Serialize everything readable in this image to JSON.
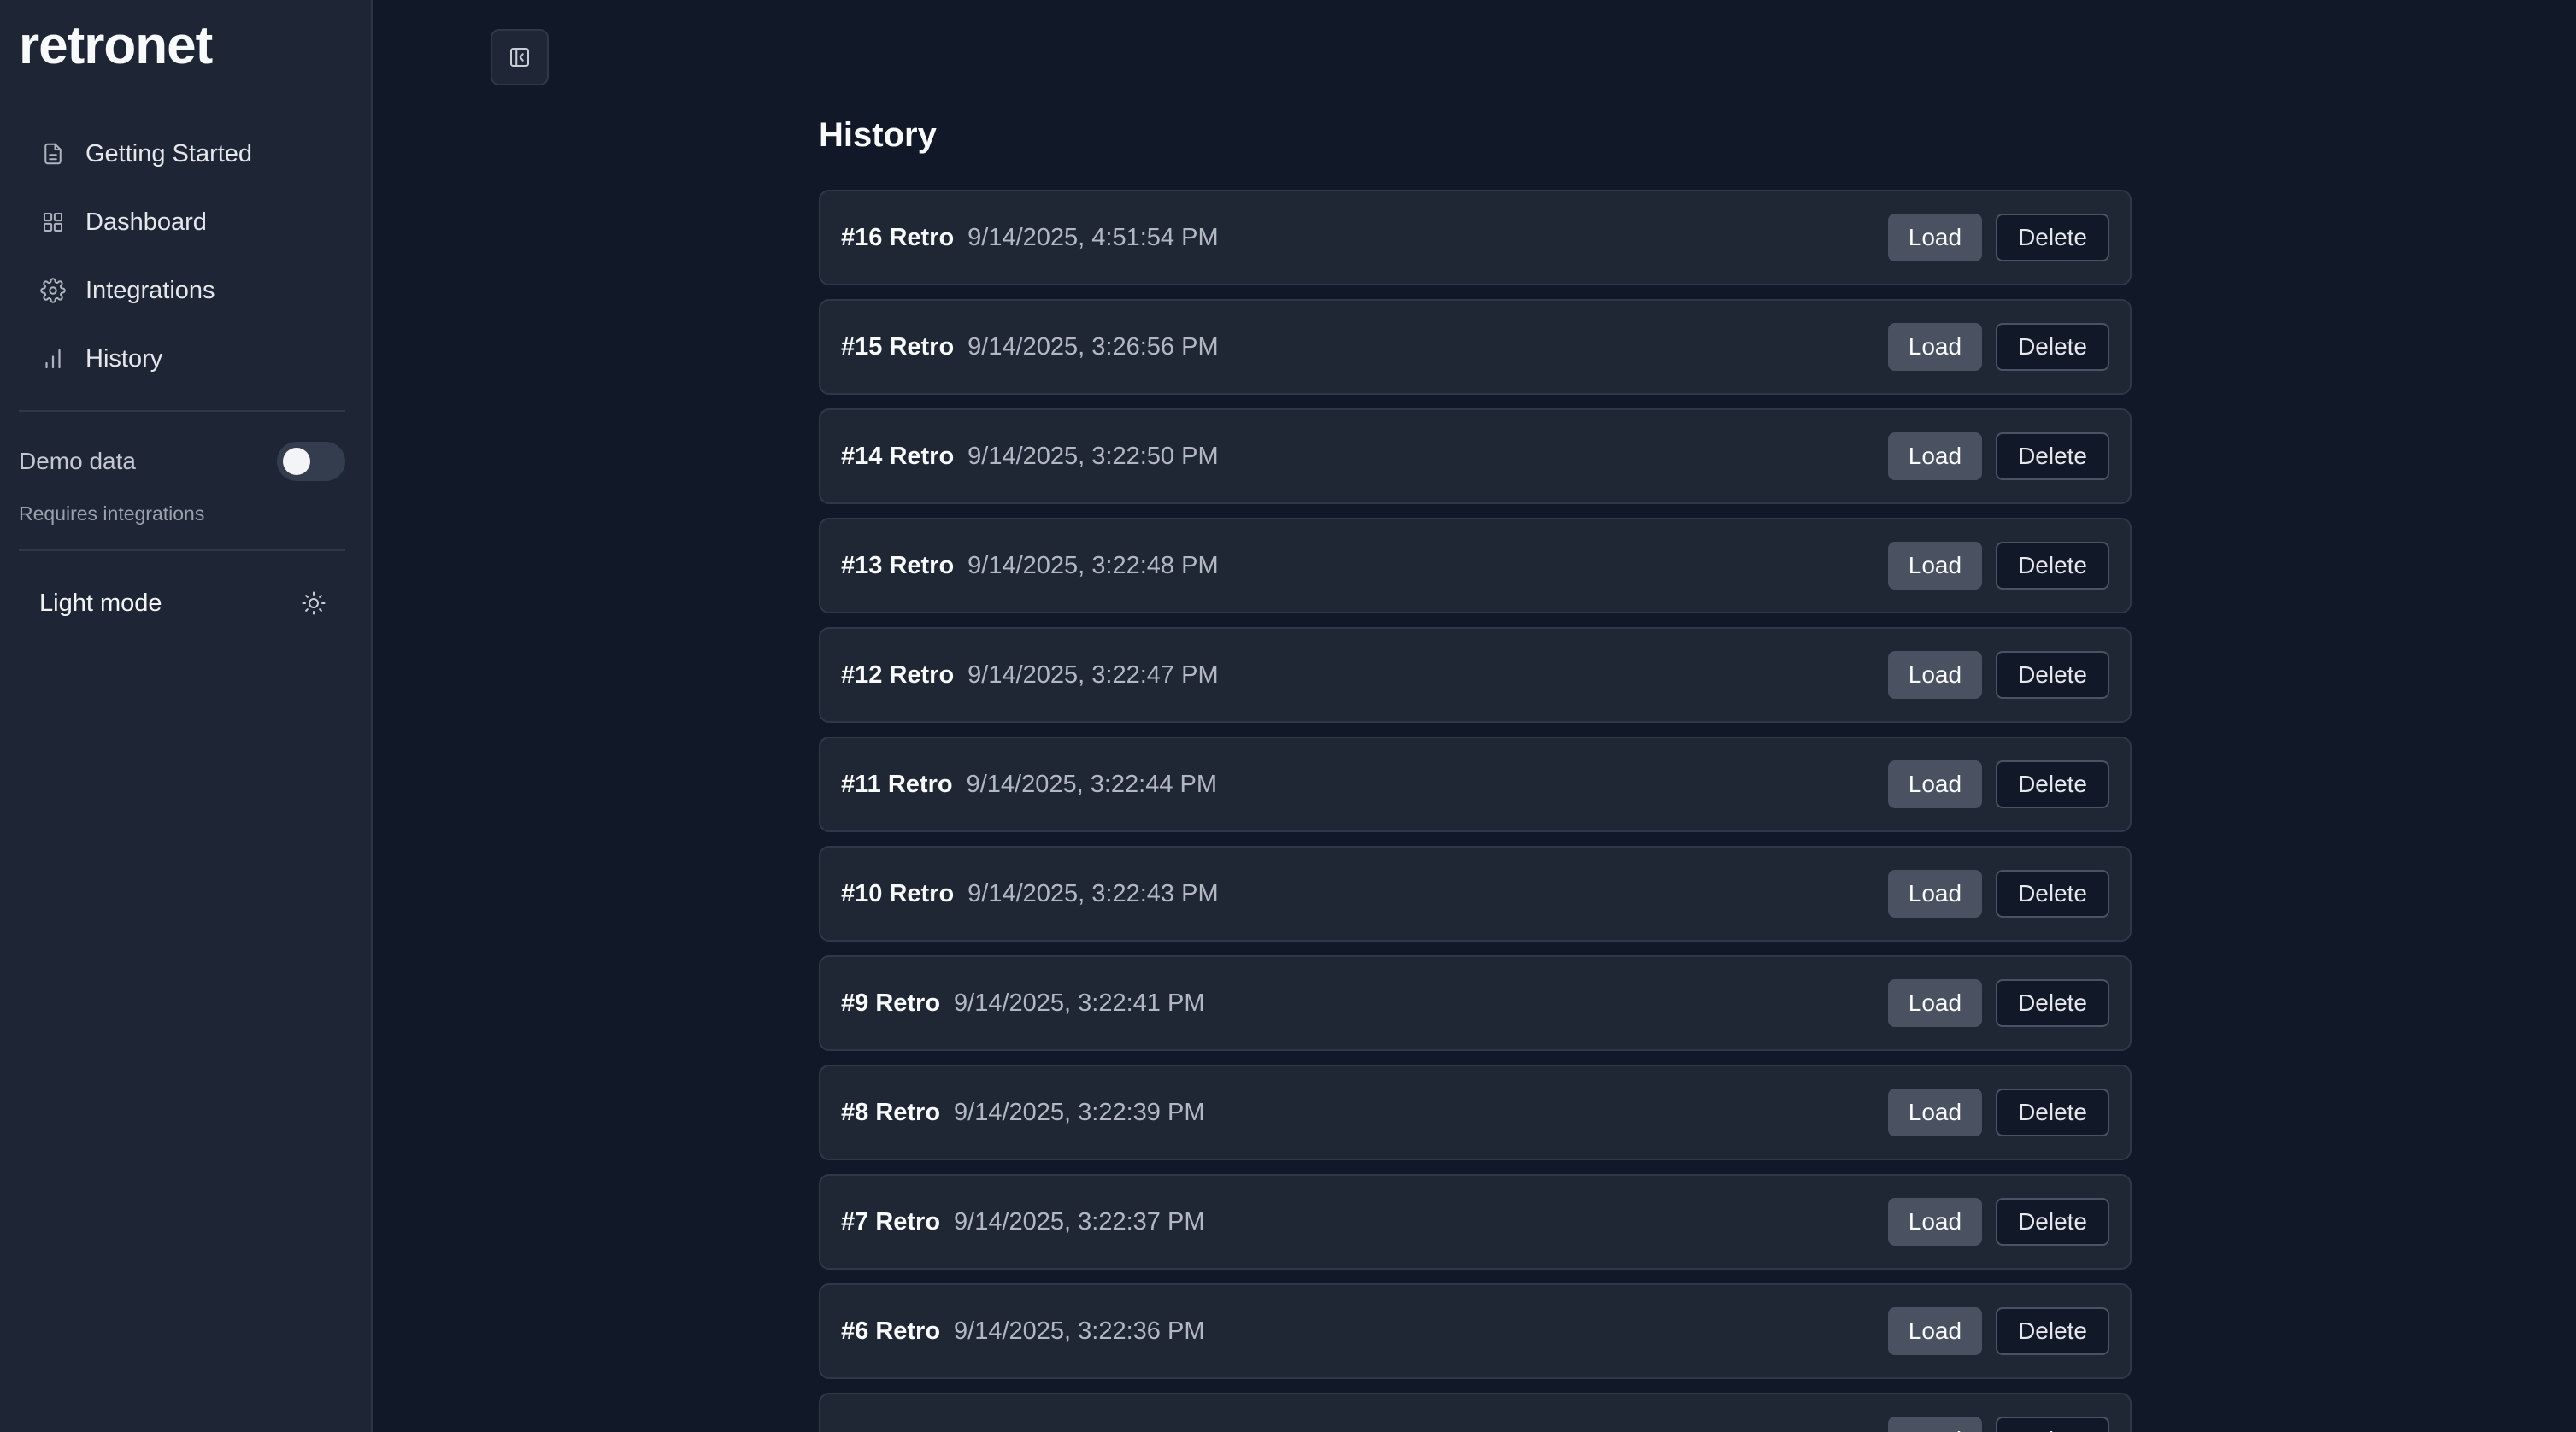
{
  "brand": "retronet",
  "sidebar": {
    "items": [
      {
        "label": "Getting Started",
        "icon": "document-icon"
      },
      {
        "label": "Dashboard",
        "icon": "grid-icon"
      },
      {
        "label": "Integrations",
        "icon": "gear-icon"
      },
      {
        "label": "History",
        "icon": "bar-chart-icon"
      }
    ],
    "demo_label": "Demo data",
    "demo_enabled": false,
    "demo_note": "Requires integrations",
    "light_mode_label": "Light mode"
  },
  "main": {
    "title": "History",
    "load_label": "Load",
    "delete_label": "Delete",
    "rows": [
      {
        "title": "#16 Retro",
        "date": "9/14/2025, 4:51:54 PM"
      },
      {
        "title": "#15 Retro",
        "date": "9/14/2025, 3:26:56 PM"
      },
      {
        "title": "#14 Retro",
        "date": "9/14/2025, 3:22:50 PM"
      },
      {
        "title": "#13 Retro",
        "date": "9/14/2025, 3:22:48 PM"
      },
      {
        "title": "#12 Retro",
        "date": "9/14/2025, 3:22:47 PM"
      },
      {
        "title": "#11 Retro",
        "date": "9/14/2025, 3:22:44 PM"
      },
      {
        "title": "#10 Retro",
        "date": "9/14/2025, 3:22:43 PM"
      },
      {
        "title": "#9 Retro",
        "date": "9/14/2025, 3:22:41 PM"
      },
      {
        "title": "#8 Retro",
        "date": "9/14/2025, 3:22:39 PM"
      },
      {
        "title": "#7 Retro",
        "date": "9/14/2025, 3:22:37 PM"
      },
      {
        "title": "#6 Retro",
        "date": "9/14/2025, 3:22:36 PM"
      },
      {
        "title": "",
        "date": ""
      }
    ]
  },
  "colors": {
    "background": "#111827",
    "sidebar": "#1e2635",
    "card": "#1f2735",
    "load_button": "#4a5261"
  }
}
